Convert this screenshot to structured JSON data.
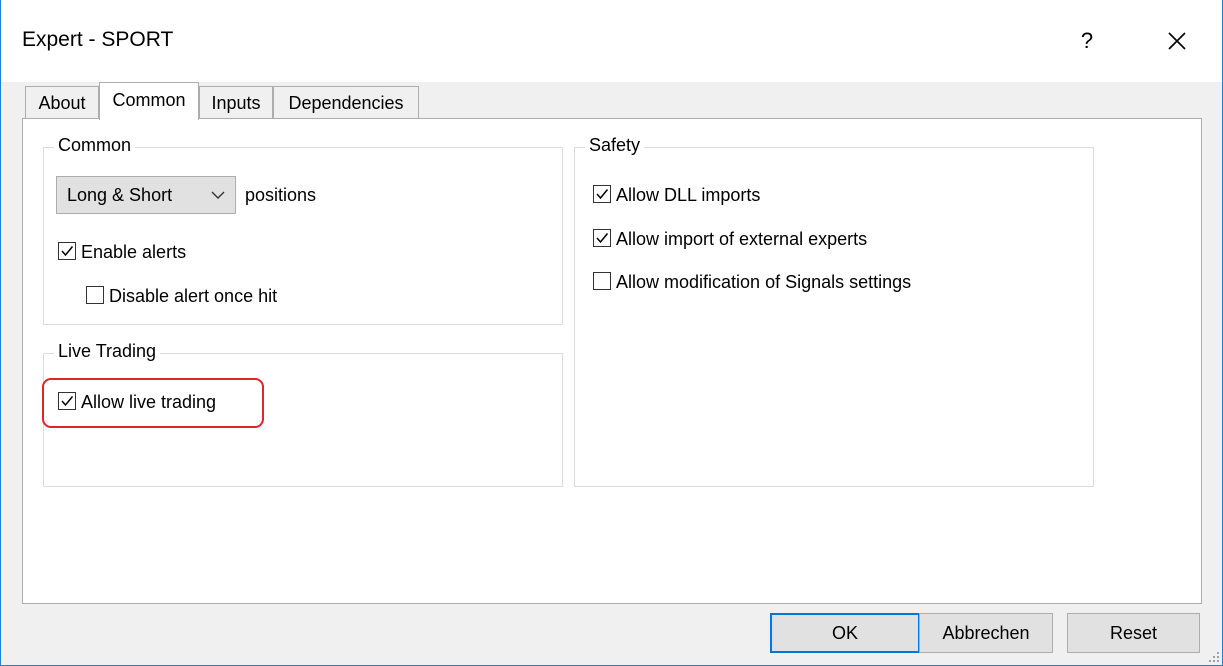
{
  "window": {
    "title": "Expert - SPORT",
    "help_label": "?"
  },
  "tabs": [
    {
      "label": "About"
    },
    {
      "label": "Common"
    },
    {
      "label": "Inputs"
    },
    {
      "label": "Dependencies"
    }
  ],
  "active_tab": "Common",
  "common_group": {
    "title": "Common",
    "positions_select": {
      "value": "Long & Short"
    },
    "positions_suffix": "positions",
    "enable_alerts": {
      "label": "Enable alerts",
      "checked": true
    },
    "disable_alert_once_hit": {
      "label": "Disable alert once hit",
      "checked": false
    }
  },
  "live_trading_group": {
    "title": "Live Trading",
    "allow_live_trading": {
      "label": "Allow live trading",
      "checked": true
    }
  },
  "safety_group": {
    "title": "Safety",
    "allow_dll_imports": {
      "label": "Allow DLL imports",
      "checked": true
    },
    "allow_import_external": {
      "label": "Allow import of external experts",
      "checked": true
    },
    "allow_signals_modification": {
      "label": "Allow modification of Signals settings",
      "checked": false
    }
  },
  "buttons": {
    "ok": "OK",
    "cancel": "Abbrechen",
    "reset": "Reset"
  },
  "colors": {
    "highlight": "#e0262a",
    "accent": "#0078d7"
  },
  "icons": {
    "close": "close-icon",
    "chevron": "chevron-down-icon",
    "check": "checkmark-icon",
    "grip": "resize-grip-icon"
  }
}
